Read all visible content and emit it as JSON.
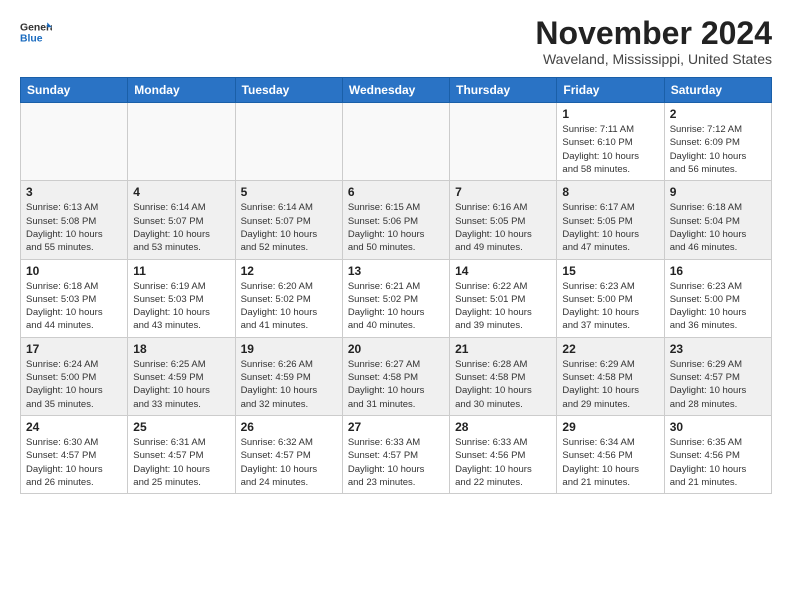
{
  "header": {
    "logo_line1": "General",
    "logo_line2": "Blue",
    "title": "November 2024",
    "subtitle": "Waveland, Mississippi, United States"
  },
  "days_of_week": [
    "Sunday",
    "Monday",
    "Tuesday",
    "Wednesday",
    "Thursday",
    "Friday",
    "Saturday"
  ],
  "weeks": [
    [
      {
        "day": "",
        "info": ""
      },
      {
        "day": "",
        "info": ""
      },
      {
        "day": "",
        "info": ""
      },
      {
        "day": "",
        "info": ""
      },
      {
        "day": "",
        "info": ""
      },
      {
        "day": "1",
        "info": "Sunrise: 7:11 AM\nSunset: 6:10 PM\nDaylight: 10 hours\nand 58 minutes."
      },
      {
        "day": "2",
        "info": "Sunrise: 7:12 AM\nSunset: 6:09 PM\nDaylight: 10 hours\nand 56 minutes."
      }
    ],
    [
      {
        "day": "3",
        "info": "Sunrise: 6:13 AM\nSunset: 5:08 PM\nDaylight: 10 hours\nand 55 minutes."
      },
      {
        "day": "4",
        "info": "Sunrise: 6:14 AM\nSunset: 5:07 PM\nDaylight: 10 hours\nand 53 minutes."
      },
      {
        "day": "5",
        "info": "Sunrise: 6:14 AM\nSunset: 5:07 PM\nDaylight: 10 hours\nand 52 minutes."
      },
      {
        "day": "6",
        "info": "Sunrise: 6:15 AM\nSunset: 5:06 PM\nDaylight: 10 hours\nand 50 minutes."
      },
      {
        "day": "7",
        "info": "Sunrise: 6:16 AM\nSunset: 5:05 PM\nDaylight: 10 hours\nand 49 minutes."
      },
      {
        "day": "8",
        "info": "Sunrise: 6:17 AM\nSunset: 5:05 PM\nDaylight: 10 hours\nand 47 minutes."
      },
      {
        "day": "9",
        "info": "Sunrise: 6:18 AM\nSunset: 5:04 PM\nDaylight: 10 hours\nand 46 minutes."
      }
    ],
    [
      {
        "day": "10",
        "info": "Sunrise: 6:18 AM\nSunset: 5:03 PM\nDaylight: 10 hours\nand 44 minutes."
      },
      {
        "day": "11",
        "info": "Sunrise: 6:19 AM\nSunset: 5:03 PM\nDaylight: 10 hours\nand 43 minutes."
      },
      {
        "day": "12",
        "info": "Sunrise: 6:20 AM\nSunset: 5:02 PM\nDaylight: 10 hours\nand 41 minutes."
      },
      {
        "day": "13",
        "info": "Sunrise: 6:21 AM\nSunset: 5:02 PM\nDaylight: 10 hours\nand 40 minutes."
      },
      {
        "day": "14",
        "info": "Sunrise: 6:22 AM\nSunset: 5:01 PM\nDaylight: 10 hours\nand 39 minutes."
      },
      {
        "day": "15",
        "info": "Sunrise: 6:23 AM\nSunset: 5:00 PM\nDaylight: 10 hours\nand 37 minutes."
      },
      {
        "day": "16",
        "info": "Sunrise: 6:23 AM\nSunset: 5:00 PM\nDaylight: 10 hours\nand 36 minutes."
      }
    ],
    [
      {
        "day": "17",
        "info": "Sunrise: 6:24 AM\nSunset: 5:00 PM\nDaylight: 10 hours\nand 35 minutes."
      },
      {
        "day": "18",
        "info": "Sunrise: 6:25 AM\nSunset: 4:59 PM\nDaylight: 10 hours\nand 33 minutes."
      },
      {
        "day": "19",
        "info": "Sunrise: 6:26 AM\nSunset: 4:59 PM\nDaylight: 10 hours\nand 32 minutes."
      },
      {
        "day": "20",
        "info": "Sunrise: 6:27 AM\nSunset: 4:58 PM\nDaylight: 10 hours\nand 31 minutes."
      },
      {
        "day": "21",
        "info": "Sunrise: 6:28 AM\nSunset: 4:58 PM\nDaylight: 10 hours\nand 30 minutes."
      },
      {
        "day": "22",
        "info": "Sunrise: 6:29 AM\nSunset: 4:58 PM\nDaylight: 10 hours\nand 29 minutes."
      },
      {
        "day": "23",
        "info": "Sunrise: 6:29 AM\nSunset: 4:57 PM\nDaylight: 10 hours\nand 28 minutes."
      }
    ],
    [
      {
        "day": "24",
        "info": "Sunrise: 6:30 AM\nSunset: 4:57 PM\nDaylight: 10 hours\nand 26 minutes."
      },
      {
        "day": "25",
        "info": "Sunrise: 6:31 AM\nSunset: 4:57 PM\nDaylight: 10 hours\nand 25 minutes."
      },
      {
        "day": "26",
        "info": "Sunrise: 6:32 AM\nSunset: 4:57 PM\nDaylight: 10 hours\nand 24 minutes."
      },
      {
        "day": "27",
        "info": "Sunrise: 6:33 AM\nSunset: 4:57 PM\nDaylight: 10 hours\nand 23 minutes."
      },
      {
        "day": "28",
        "info": "Sunrise: 6:33 AM\nSunset: 4:56 PM\nDaylight: 10 hours\nand 22 minutes."
      },
      {
        "day": "29",
        "info": "Sunrise: 6:34 AM\nSunset: 4:56 PM\nDaylight: 10 hours\nand 21 minutes."
      },
      {
        "day": "30",
        "info": "Sunrise: 6:35 AM\nSunset: 4:56 PM\nDaylight: 10 hours\nand 21 minutes."
      }
    ]
  ]
}
